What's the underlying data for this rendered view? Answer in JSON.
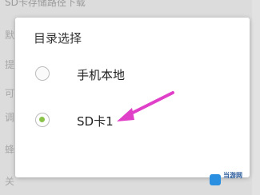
{
  "background": {
    "top_text": "SD卡存储路径下载",
    "left_chars": [
      "默",
      "提",
      "可",
      "调",
      "蜂",
      "关"
    ]
  },
  "dialog": {
    "title": "目录选择",
    "options": [
      {
        "label": "手机本地",
        "selected": false
      },
      {
        "label": "SD卡1",
        "selected": true
      }
    ],
    "selected_color": "#8bc34a",
    "arrow_color": "#e040c8"
  },
  "watermark": {
    "text": "当游网"
  }
}
